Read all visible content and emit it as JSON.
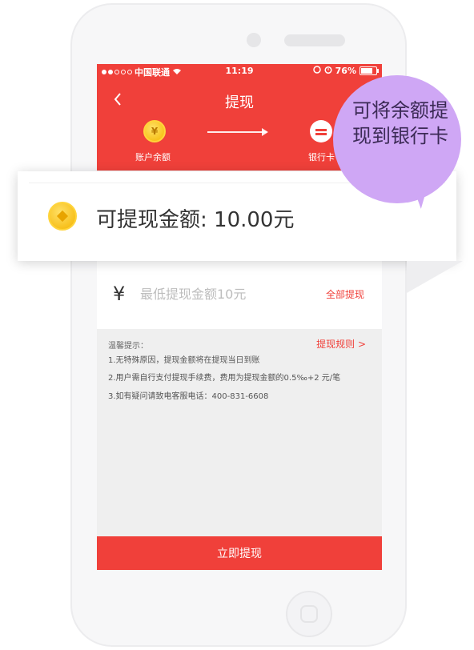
{
  "status_bar": {
    "carrier": "中国联通",
    "time": "11:19",
    "battery": "76%"
  },
  "nav": {
    "title": "提现"
  },
  "flow": {
    "from_label": "账户余额",
    "to_label": "银行卡"
  },
  "callout": {
    "text": "可提现金额: 10.00元"
  },
  "bubble": {
    "text": "可将余额提现到银行卡"
  },
  "amount": {
    "currency_symbol": "¥",
    "placeholder": "最低提现金额10元",
    "withdraw_all": "全部提现"
  },
  "tips": {
    "heading": "温馨提示：",
    "rules_link": "提现规则 >",
    "lines": [
      "1.无特殊原因，提现金额将在提现当日到账",
      "2.用户需自行支付提现手续费，费用为提现金额的0.5‰+2 元/笔",
      "3.如有疑问请致电客服电话：400-831-6608"
    ]
  },
  "submit": {
    "label": "立即提现"
  },
  "colors": {
    "brand_red": "#f0403a",
    "bubble_purple": "#cfa7f5"
  }
}
